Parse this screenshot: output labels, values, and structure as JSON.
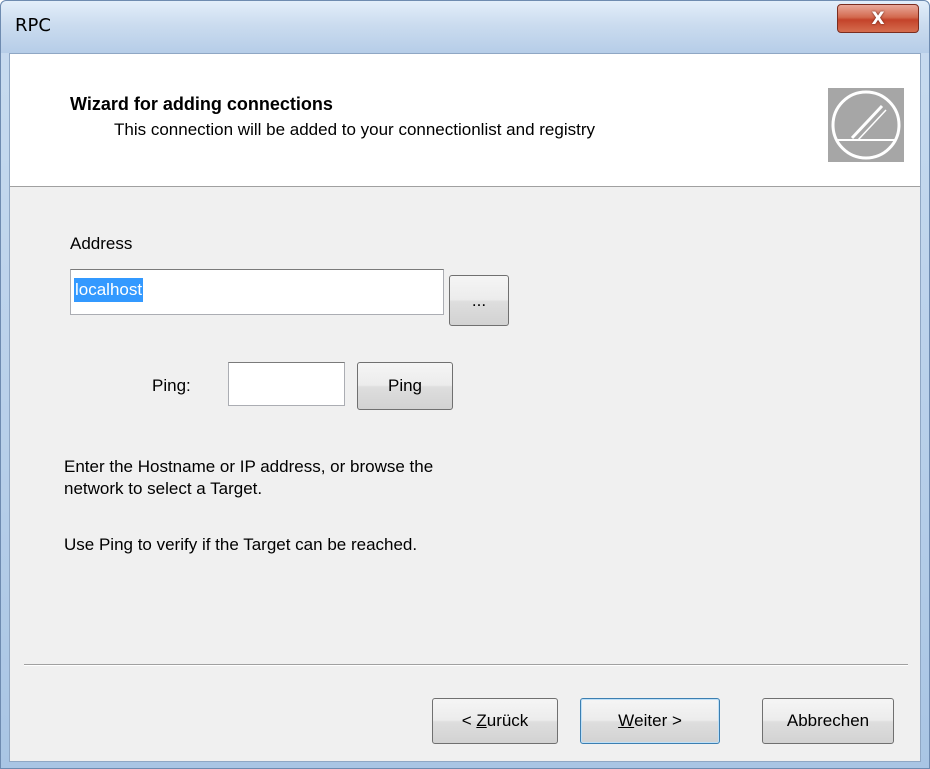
{
  "window": {
    "title": "RPC",
    "close_label": "X"
  },
  "header": {
    "title": "Wizard for adding connections",
    "subtitle": "This connection will be added to your connectionlist and registry",
    "logo_icon": "pen-circle-logo-icon"
  },
  "address": {
    "label": "Address",
    "value": "localhost",
    "browse_label": "..."
  },
  "ping": {
    "label": "Ping:",
    "value": "",
    "button_label": "Ping"
  },
  "info": {
    "line1": "Enter the Hostname or IP address, or browse the",
    "line2": "network to select a Target.",
    "line3": "Use Ping to verify if the Target can be reached."
  },
  "footer": {
    "back_prefix": "< ",
    "back_mnemonic": "Z",
    "back_rest": "urück",
    "next_mnemonic": "W",
    "next_rest": "eiter >",
    "cancel_label": "Abbrechen"
  },
  "colors": {
    "selection": "#3399ff",
    "dialog_bg": "#f0f0f0",
    "close_button": "#c4432a"
  }
}
